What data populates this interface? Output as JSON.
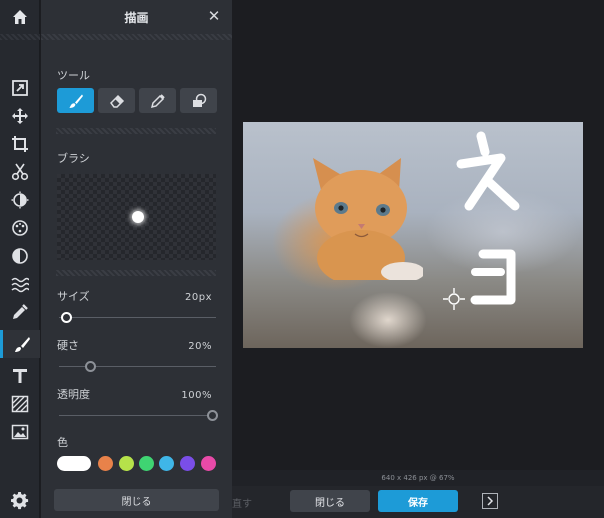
{
  "panel": {
    "title": "描画",
    "close_glyph": "✕",
    "tools_label": "ツール",
    "brush_label": "ブラシ",
    "size_label": "サイズ",
    "size_value": "20px",
    "hardness_label": "硬さ",
    "hardness_value": "20%",
    "opacity_label": "透明度",
    "opacity_value": "100%",
    "color_label": "色",
    "close_button": "閉じる",
    "swatches": [
      "#ffffff",
      "#e8824a",
      "#b6e24a",
      "#3fd472",
      "#3fb6e8",
      "#7a4ee8",
      "#e84aa8"
    ]
  },
  "sliders": {
    "size": 0.05,
    "hardness": 0.2,
    "opacity": 1.0
  },
  "status": {
    "dimensions": "640 x 426 px @ 67%"
  },
  "footer": {
    "redo_label": "直す",
    "close_label": "閉じる",
    "save_label": "保存"
  },
  "canvas": {
    "drawn_text": "ネコ"
  },
  "colors": {
    "accent": "#1d9bd7"
  },
  "icons": {
    "rail": [
      "home-icon",
      "export-icon",
      "move-icon",
      "crop-icon",
      "cut-icon",
      "adjust-icon",
      "filter-icon",
      "vignette-icon",
      "wave-icon",
      "dropper-icon",
      "brush-icon",
      "text-icon",
      "texture-icon",
      "image-icon",
      "gear-icon"
    ]
  }
}
